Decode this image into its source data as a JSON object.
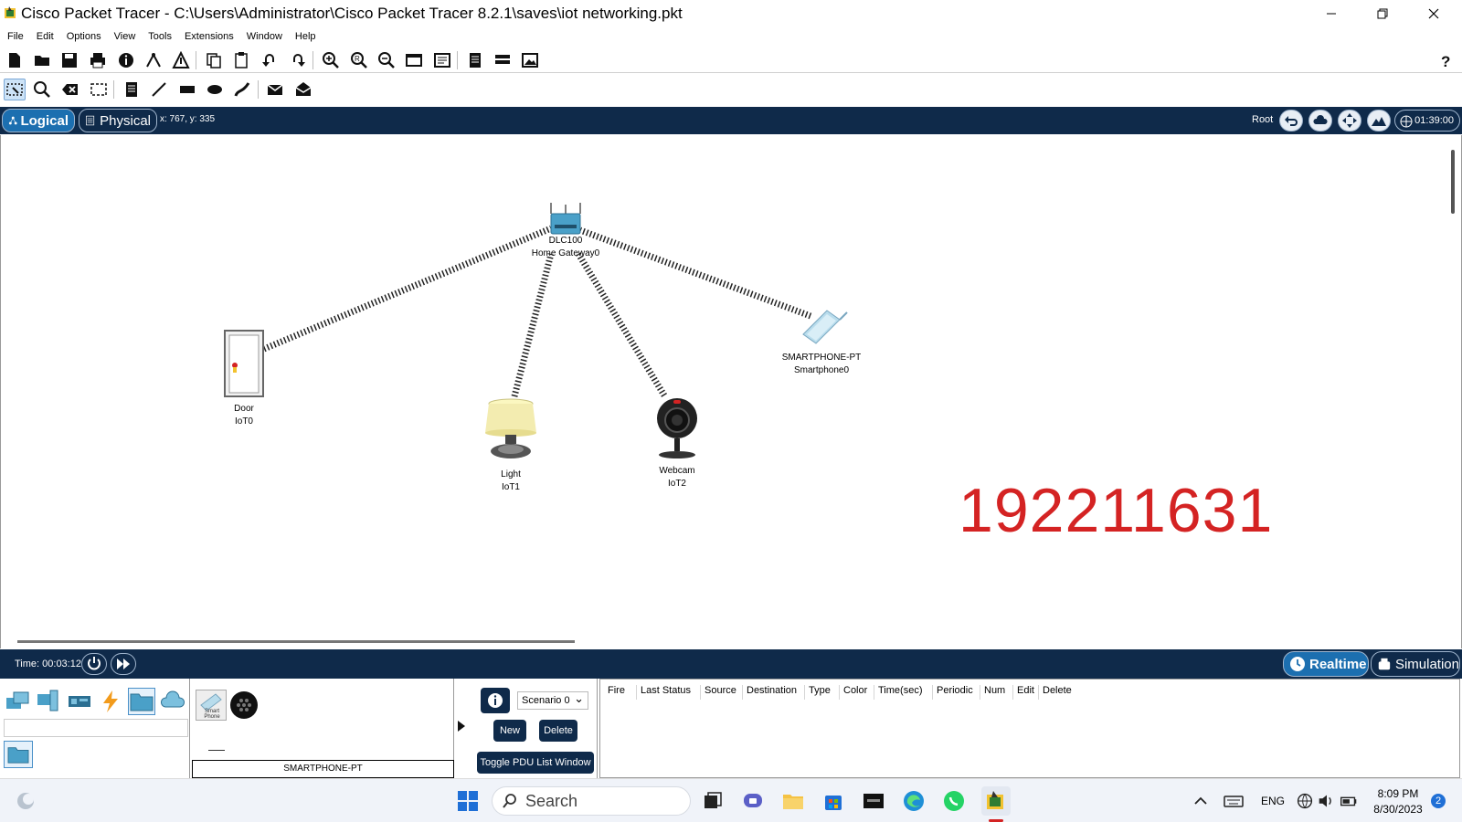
{
  "window": {
    "title": "Cisco Packet Tracer - C:\\Users\\Administrator\\Cisco Packet Tracer 8.2.1\\saves\\iot networking.pkt",
    "minimize_icon": "minimize-icon",
    "maximize_icon": "restore-icon",
    "close_icon": "close-icon"
  },
  "menu": [
    "File",
    "Edit",
    "Options",
    "View",
    "Tools",
    "Extensions",
    "Window",
    "Help"
  ],
  "view_bar": {
    "logical_label": "Logical",
    "physical_label": "Physical",
    "coords": "x: 767, y: 335",
    "root_label": "Root",
    "clock": "01:39:00"
  },
  "workspace": {
    "devices": [
      {
        "model": "DLC100",
        "name": "Home Gateway0",
        "icon": "home-gateway-icon"
      },
      {
        "model": "Door",
        "name": "IoT0",
        "icon": "door-icon"
      },
      {
        "model": "Light",
        "name": "IoT1",
        "icon": "lamp-icon"
      },
      {
        "model": "Webcam",
        "name": "IoT2",
        "icon": "webcam-icon"
      },
      {
        "model": "SMARTPHONE-PT",
        "name": "Smartphone0",
        "icon": "smartphone-icon"
      }
    ],
    "watermark": "192211631"
  },
  "time_bar": {
    "time": "Time: 00:03:12",
    "realtime_label": "Realtime",
    "simulation_label": "Simulation"
  },
  "bottom": {
    "device_selected": "SMARTPHONE-PT",
    "smart_phone_caption": "Smart Phone",
    "scenario": "Scenario 0",
    "new_label": "New",
    "delete_label": "Delete",
    "toggle_label": "Toggle PDU List Window",
    "pdu_columns": [
      "Fire",
      "Last Status",
      "Source",
      "Destination",
      "Type",
      "Color",
      "Time(sec)",
      "Periodic",
      "Num",
      "Edit",
      "Delete"
    ]
  },
  "taskbar": {
    "search_placeholder": "Search",
    "lang": "ENG",
    "time": "8:09 PM",
    "date": "8/30/2023",
    "notifications": "2"
  },
  "colors": {
    "bar_navy": "#0f2a4a",
    "accent_blue": "#1c6fb0",
    "watermark_red": "#d42323"
  }
}
